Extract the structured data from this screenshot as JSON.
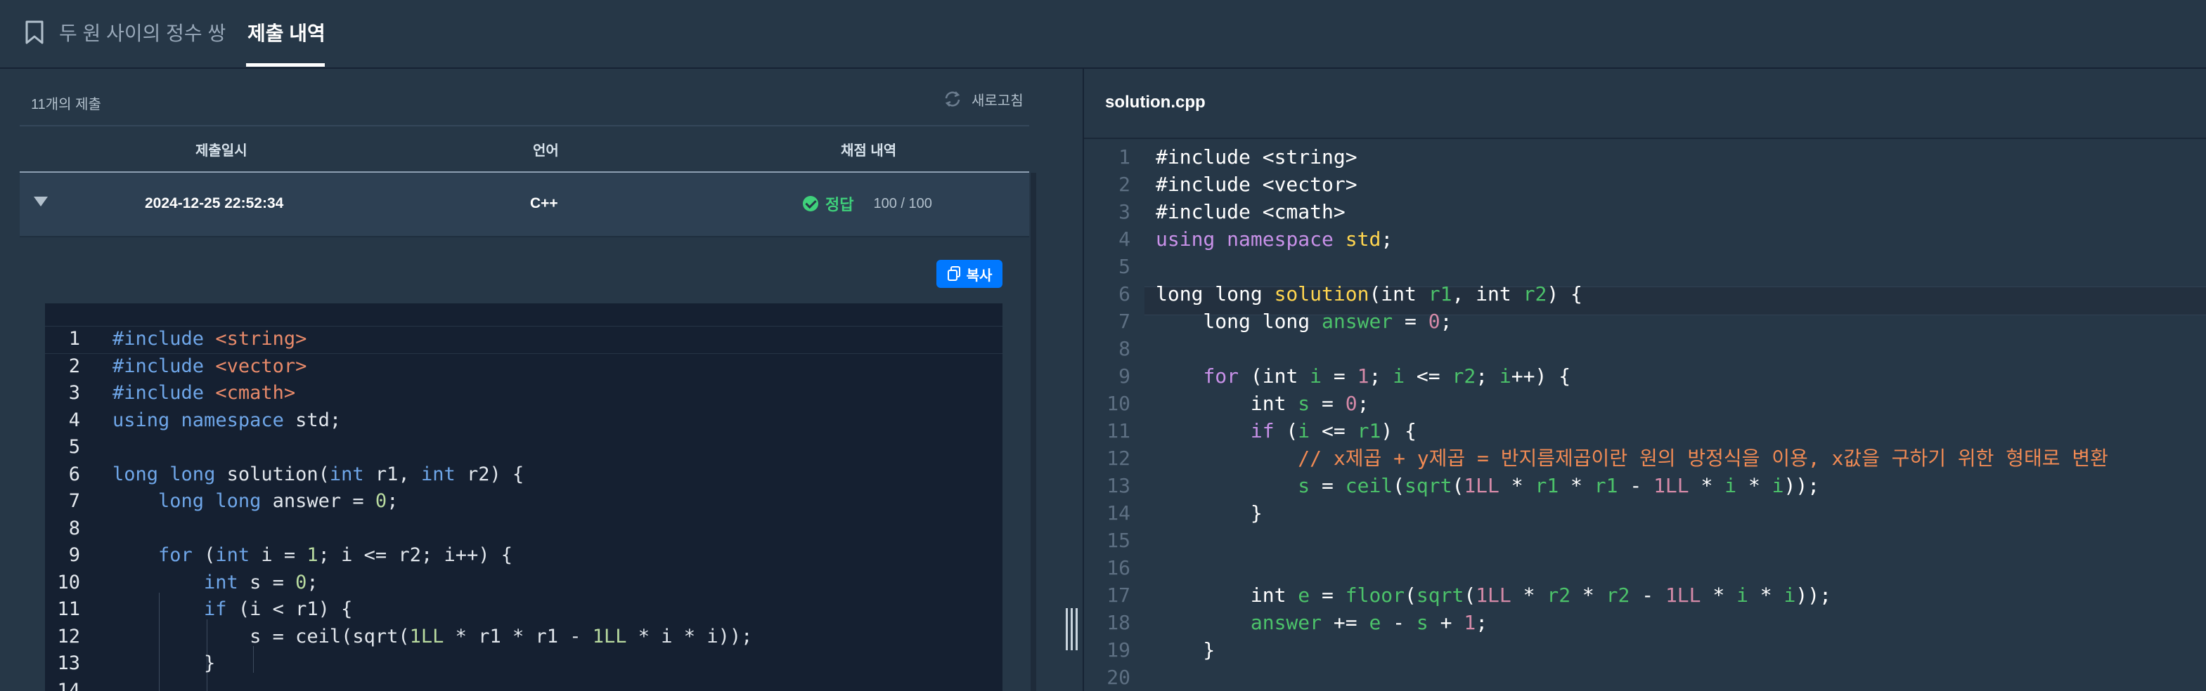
{
  "header": {
    "problem_title": "두 원 사이의 정수 쌍",
    "active_tab": "제출 내역"
  },
  "submissions": {
    "count_label": "11개의 제출",
    "refresh_label": "새로고침",
    "columns": [
      "제출일시",
      "언어",
      "채점 내역"
    ],
    "row": {
      "datetime": "2024-12-25 22:52:34",
      "language": "C++",
      "status": "정답",
      "score": "100 / 100"
    },
    "copy_label": "복사",
    "code_lines": [
      "#include <string>",
      "#include <vector>",
      "#include <cmath>",
      "using namespace std;",
      "",
      "long long solution(int r1, int r2) {",
      "    long long answer = 0;",
      "",
      "    for (int i = 1; i <= r2; i++) {",
      "        int s = 0;",
      "        if (i < r1) {",
      "            s = ceil(sqrt(1LL * r1 * r1 - 1LL * i * i));",
      "        }",
      ""
    ],
    "line_numbers": [
      "1",
      "2",
      "3",
      "4",
      "5",
      "6",
      "7",
      "8",
      "9",
      "10",
      "11",
      "12",
      "13",
      "14"
    ]
  },
  "editor": {
    "file_name": "solution.cpp",
    "line_numbers": [
      "1",
      "2",
      "3",
      "4",
      "5",
      "6",
      "7",
      "8",
      "9",
      "10",
      "11",
      "12",
      "13",
      "14",
      "15",
      "16",
      "17",
      "18",
      "19",
      "20"
    ],
    "code_lines": [
      "#include <string>",
      "#include <vector>",
      "#include <cmath>",
      "using namespace std;",
      "",
      "long long solution(int r1, int r2) {",
      "    long long answer = 0;",
      "",
      "    for (int i = 1; i <= r2; i++) {",
      "        int s = 0;",
      "        if (i <= r1) {",
      "            // x제곱 + y제곱 = 반지름제곱이란 원의 방정식을 이용, x값을 구하기 위한 형태로 변환",
      "            s = ceil(sqrt(1LL * r1 * r1 - 1LL * i * i));",
      "        }",
      "",
      "",
      "        int e = floor(sqrt(1LL * r2 * r2 - 1LL * i * i));",
      "        answer += e - s + 1;",
      "    }",
      ""
    ]
  },
  "colors": {
    "background": "#263747",
    "accent": "#0078ff",
    "success": "#3fd07b"
  }
}
